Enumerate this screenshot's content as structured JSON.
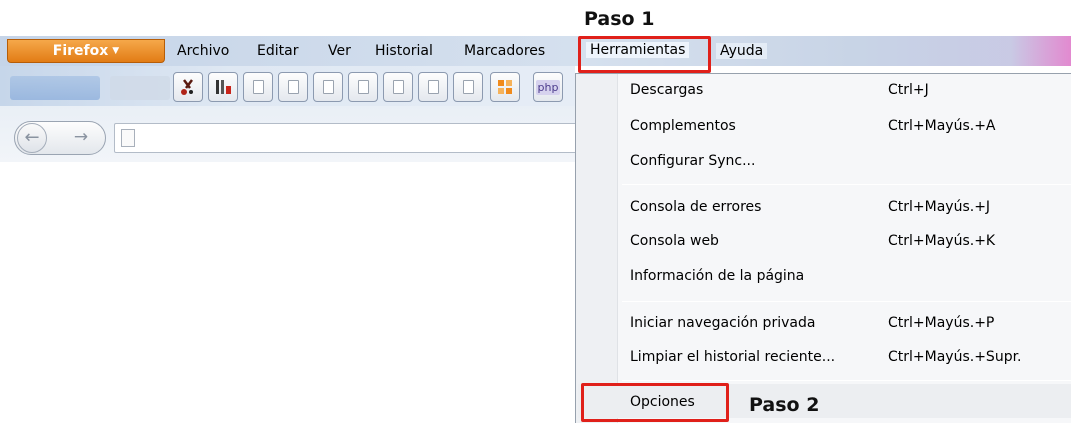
{
  "annotations": {
    "step1": "Paso 1",
    "step2": "Paso 2",
    "highlight_color": "#e0201a"
  },
  "firefox_button": {
    "label": "Firefox",
    "arrow": "▼",
    "color": "#e8861e"
  },
  "menubar": {
    "items": [
      {
        "label": "Archivo"
      },
      {
        "label": "Editar"
      },
      {
        "label": "Ver"
      },
      {
        "label": "Historial"
      },
      {
        "label": "Marcadores"
      },
      {
        "label": "Herramientas"
      },
      {
        "label": "Ayuda"
      }
    ]
  },
  "toolbar": {
    "icons": [
      "scissors-icon",
      "tools-icon",
      "blank-page-icon",
      "blank-page-icon",
      "blank-page-icon",
      "blank-page-icon",
      "blank-page-icon",
      "puzzle-icon",
      "php-icon"
    ],
    "php_label": "php"
  },
  "navigation": {
    "back": "←",
    "forward": "→",
    "url_value": ""
  },
  "tools_menu": {
    "groups": [
      [
        {
          "label": "Descargas",
          "shortcut": "Ctrl+J"
        },
        {
          "label": "Complementos",
          "shortcut": "Ctrl+Mayús.+A"
        },
        {
          "label": "Configurar Sync...",
          "shortcut": ""
        }
      ],
      [
        {
          "label": "Consola de errores",
          "shortcut": "Ctrl+Mayús.+J"
        },
        {
          "label": "Consola web",
          "shortcut": "Ctrl+Mayús.+K"
        },
        {
          "label": "Información de la página",
          "shortcut": ""
        }
      ],
      [
        {
          "label": "Iniciar navegación privada",
          "shortcut": "Ctrl+Mayús.+P"
        },
        {
          "label": "Limpiar el historial reciente...",
          "shortcut": "Ctrl+Mayús.+Supr."
        }
      ],
      [
        {
          "label": "Opciones",
          "shortcut": ""
        }
      ]
    ]
  }
}
